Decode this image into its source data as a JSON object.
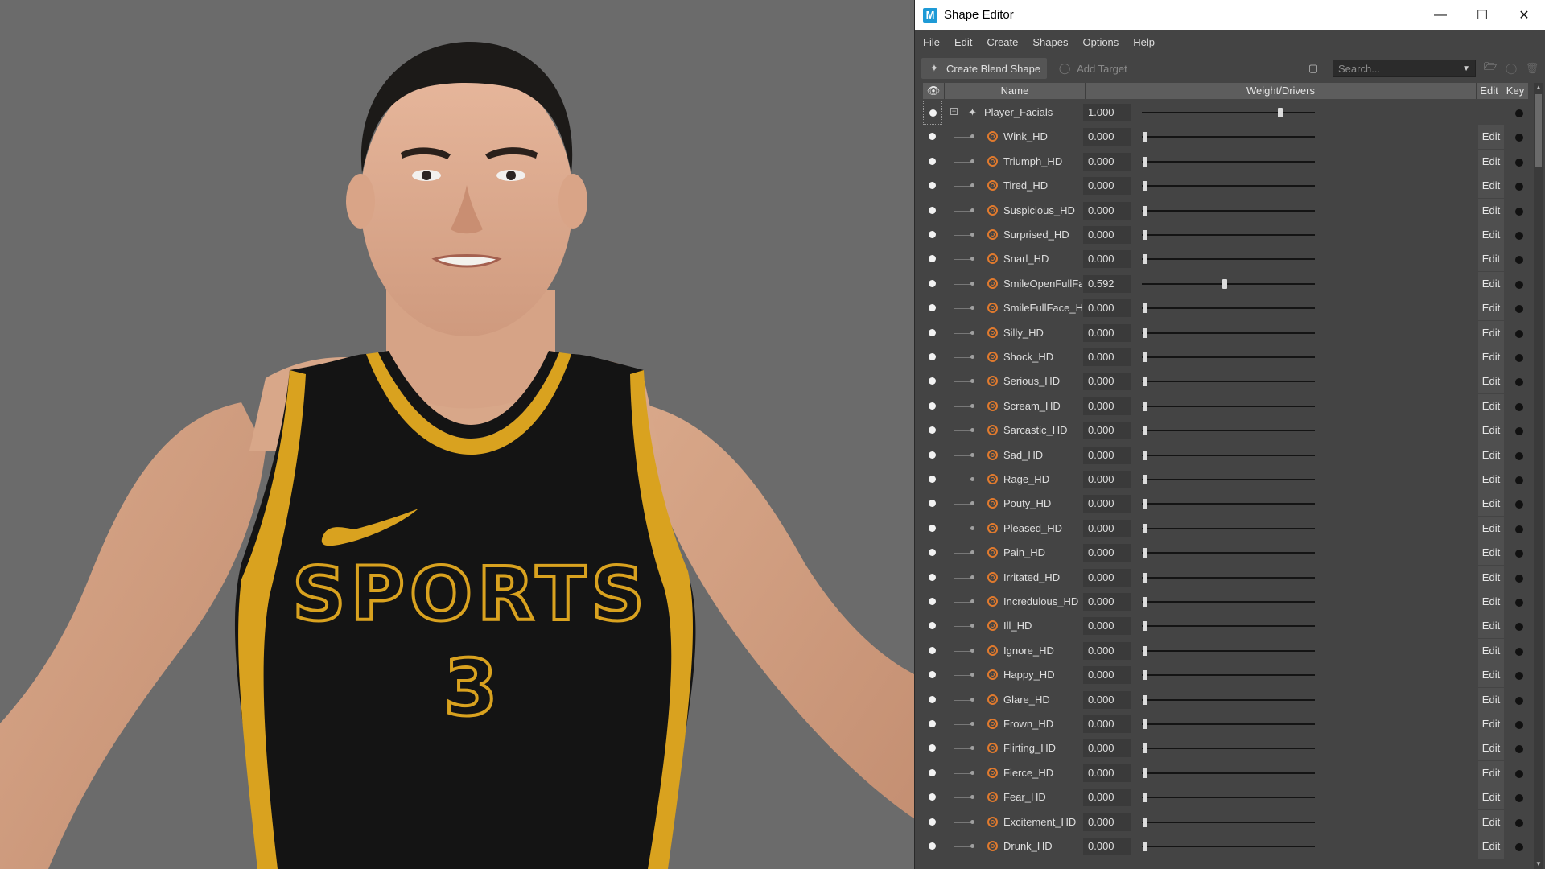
{
  "window": {
    "title": "Shape Editor",
    "app_icon": "M",
    "controls": [
      "minimize-icon",
      "maximize-icon",
      "close-icon"
    ]
  },
  "menu": [
    "File",
    "Edit",
    "Create",
    "Shapes",
    "Options",
    "Help"
  ],
  "toolbar": {
    "create_label": "Create Blend Shape",
    "add_label": "Add Target",
    "search_placeholder": "Search..."
  },
  "columns": {
    "name": "Name",
    "weight": "Weight/Drivers",
    "edit": "Edit",
    "key": "Key"
  },
  "jersey": {
    "text": "SPORTS",
    "number": "3"
  },
  "blend_shape": {
    "name": "Player_Facials",
    "weight": "1.000",
    "slider": 1.0
  },
  "targets": [
    {
      "name": "Wink_HD",
      "weight": "0.000",
      "slider": 0.0
    },
    {
      "name": "Triumph_HD",
      "weight": "0.000",
      "slider": 0.0
    },
    {
      "name": "Tired_HD",
      "weight": "0.000",
      "slider": 0.0
    },
    {
      "name": "Suspicious_HD",
      "weight": "0.000",
      "slider": 0.0
    },
    {
      "name": "Surprised_HD",
      "weight": "0.000",
      "slider": 0.0
    },
    {
      "name": "Snarl_HD",
      "weight": "0.000",
      "slider": 0.0
    },
    {
      "name": "SmileOpenFullFa",
      "weight": "0.592",
      "slider": 0.592
    },
    {
      "name": "SmileFullFace_H",
      "weight": "0.000",
      "slider": 0.0
    },
    {
      "name": "Silly_HD",
      "weight": "0.000",
      "slider": 0.0
    },
    {
      "name": "Shock_HD",
      "weight": "0.000",
      "slider": 0.0
    },
    {
      "name": "Serious_HD",
      "weight": "0.000",
      "slider": 0.0
    },
    {
      "name": "Scream_HD",
      "weight": "0.000",
      "slider": 0.0
    },
    {
      "name": "Sarcastic_HD",
      "weight": "0.000",
      "slider": 0.0
    },
    {
      "name": "Sad_HD",
      "weight": "0.000",
      "slider": 0.0
    },
    {
      "name": "Rage_HD",
      "weight": "0.000",
      "slider": 0.0
    },
    {
      "name": "Pouty_HD",
      "weight": "0.000",
      "slider": 0.0
    },
    {
      "name": "Pleased_HD",
      "weight": "0.000",
      "slider": 0.0
    },
    {
      "name": "Pain_HD",
      "weight": "0.000",
      "slider": 0.0
    },
    {
      "name": "Irritated_HD",
      "weight": "0.000",
      "slider": 0.0
    },
    {
      "name": "Incredulous_HD",
      "weight": "0.000",
      "slider": 0.0
    },
    {
      "name": "Ill_HD",
      "weight": "0.000",
      "slider": 0.0
    },
    {
      "name": "Ignore_HD",
      "weight": "0.000",
      "slider": 0.0
    },
    {
      "name": "Happy_HD",
      "weight": "0.000",
      "slider": 0.0
    },
    {
      "name": "Glare_HD",
      "weight": "0.000",
      "slider": 0.0
    },
    {
      "name": "Frown_HD",
      "weight": "0.000",
      "slider": 0.0
    },
    {
      "name": "Flirting_HD",
      "weight": "0.000",
      "slider": 0.0
    },
    {
      "name": "Fierce_HD",
      "weight": "0.000",
      "slider": 0.0
    },
    {
      "name": "Fear_HD",
      "weight": "0.000",
      "slider": 0.0
    },
    {
      "name": "Excitement_HD",
      "weight": "0.000",
      "slider": 0.0
    },
    {
      "name": "Drunk_HD",
      "weight": "0.000",
      "slider": 0.0
    }
  ],
  "colors": {
    "panel_bg": "#444444",
    "target_icon": "#e07a2e",
    "jersey": "#141414",
    "jersey_trim": "#d9a21f"
  }
}
